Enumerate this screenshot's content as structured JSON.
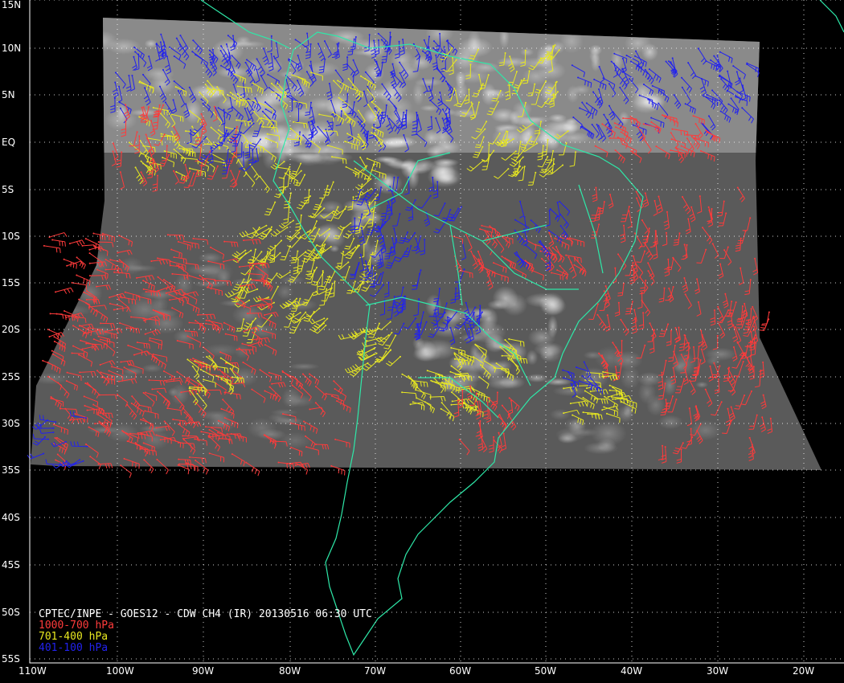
{
  "title": "CPTEC/INPE - GOES12 - CDW CH4 (IR) 20130516 06:30 UTC",
  "legend": [
    {
      "label": "1000-700 hPa",
      "color": "#ff3b3b"
    },
    {
      "label": "701-400 hPa",
      "color": "#e8e820"
    },
    {
      "label": "401-100 hPa",
      "color": "#2222ee"
    }
  ],
  "latitude_labels": [
    "15N",
    "10N",
    "5N",
    "EQ",
    "5S",
    "10S",
    "15S",
    "20S",
    "25S",
    "30S",
    "35S",
    "40S",
    "45S",
    "50S",
    "55S"
  ],
  "longitude_labels": [
    "110W",
    "100W",
    "90W",
    "80W",
    "70W",
    "60W",
    "50W",
    "40W",
    "30W",
    "20W"
  ],
  "colors": {
    "background": "#000000",
    "coastline": "#2ee8a8",
    "grid": "#ffffff",
    "text": "#ffffff"
  },
  "map_region": {
    "lat_range": [
      -55,
      15
    ],
    "lon_range": [
      -110,
      -15
    ]
  }
}
